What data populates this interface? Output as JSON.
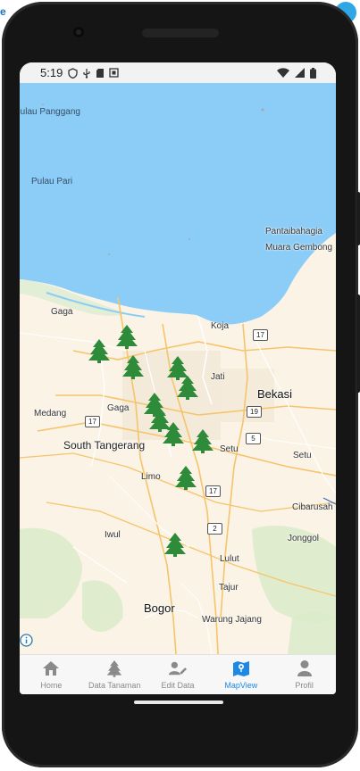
{
  "status_bar": {
    "time": "5:19",
    "left_icons": [
      "shield-icon",
      "usb-icon",
      "sd-card-icon",
      "screenshot-icon"
    ],
    "right_icons": [
      "wifi-icon",
      "signal-icon",
      "battery-icon"
    ]
  },
  "map": {
    "labels": {
      "pulau_panggang": "Pulau Panggang",
      "pulau_pari": "Pulau Pari",
      "pantaibahagia": "Pantaibahagia",
      "muara_gembong": "Muara Gembong",
      "gaga_north": "Gaga",
      "koja": "Koja",
      "jati": "Jati",
      "bekasi": "Bekasi",
      "medang": "Medang",
      "gaga_center": "Gaga",
      "south_tangerang": "South Tangerang",
      "setu_center": "Setu",
      "setu_east": "Setu",
      "limo": "Limo",
      "cibarusah": "Cibarusah",
      "iwul": "Iwul",
      "jonggol": "Jonggol",
      "lulut": "Lulut",
      "tajur": "Tajur",
      "bogor": "Bogor",
      "warung_jajang": "Warung Jajang"
    },
    "shields": {
      "r17_koja": "17",
      "r19": "19",
      "r17_west": "17",
      "r5": "5",
      "r17_south": "17",
      "r2": "2"
    },
    "marker_count": 11,
    "marker_icon": "tree-marker-icon",
    "marker_color": "#2e8b3a",
    "water_color": "#8ccdf7",
    "land_color": "#faf3e6"
  },
  "nav": {
    "items": [
      {
        "label": "Home",
        "icon": "home-icon"
      },
      {
        "label": "Data Tanaman",
        "icon": "tree-icon"
      },
      {
        "label": "Edit Data",
        "icon": "edit-person-icon"
      },
      {
        "label": "MapView",
        "icon": "map-icon"
      },
      {
        "label": "Profil",
        "icon": "person-icon"
      }
    ],
    "active": "MapView",
    "active_color": "#1e88e5"
  }
}
